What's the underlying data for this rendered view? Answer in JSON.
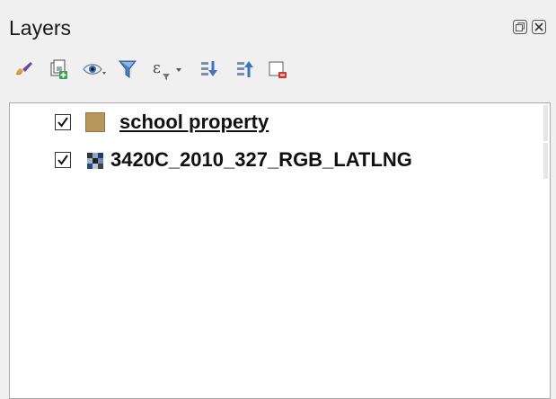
{
  "panel": {
    "title": "Layers"
  },
  "title_buttons": [
    {
      "name": "float-panel-button",
      "icon": "undock-icon"
    },
    {
      "name": "close-panel-button",
      "icon": "close-icon"
    }
  ],
  "toolbar": {
    "icons": [
      "style-brush-icon",
      "add-group-icon",
      "manage-visibility-icon",
      "filter-legend-icon",
      "filter-expression-icon",
      "expand-all-icon",
      "collapse-all-icon",
      "remove-layer-icon"
    ]
  },
  "layers": [
    {
      "name": "school property",
      "checked": true,
      "type": "vector-polygon",
      "color": "#b8985a"
    },
    {
      "name": "3420C_2010_327_RGB_LATLNG",
      "checked": true,
      "type": "raster"
    }
  ]
}
